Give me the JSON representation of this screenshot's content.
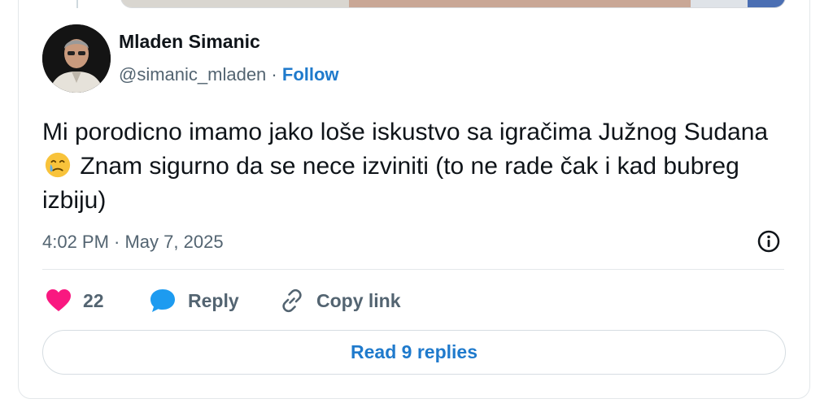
{
  "author": {
    "name": "Mladen Simanic",
    "handle": "@simanic_mladen",
    "separator": "·",
    "follow_label": "Follow"
  },
  "tweet": {
    "text_part1": "Mi porodicno imamo jako loše iskustvo sa igračima Južnog Sudana",
    "emoji": "crying-face-emoji",
    "text_part2": " Znam sigurno da se nece izviniti (to ne rade čak i kad bubreg izbiju)",
    "timestamp": "4:02 PM · May 7, 2025"
  },
  "actions": {
    "like_count": "22",
    "reply_label": "Reply",
    "copy_link_label": "Copy link"
  },
  "read_replies_label": "Read 9 replies",
  "colors": {
    "like": "#f91880",
    "reply": "#1d9bf0",
    "link": "#1f7acc",
    "secondary_text": "#536471"
  }
}
